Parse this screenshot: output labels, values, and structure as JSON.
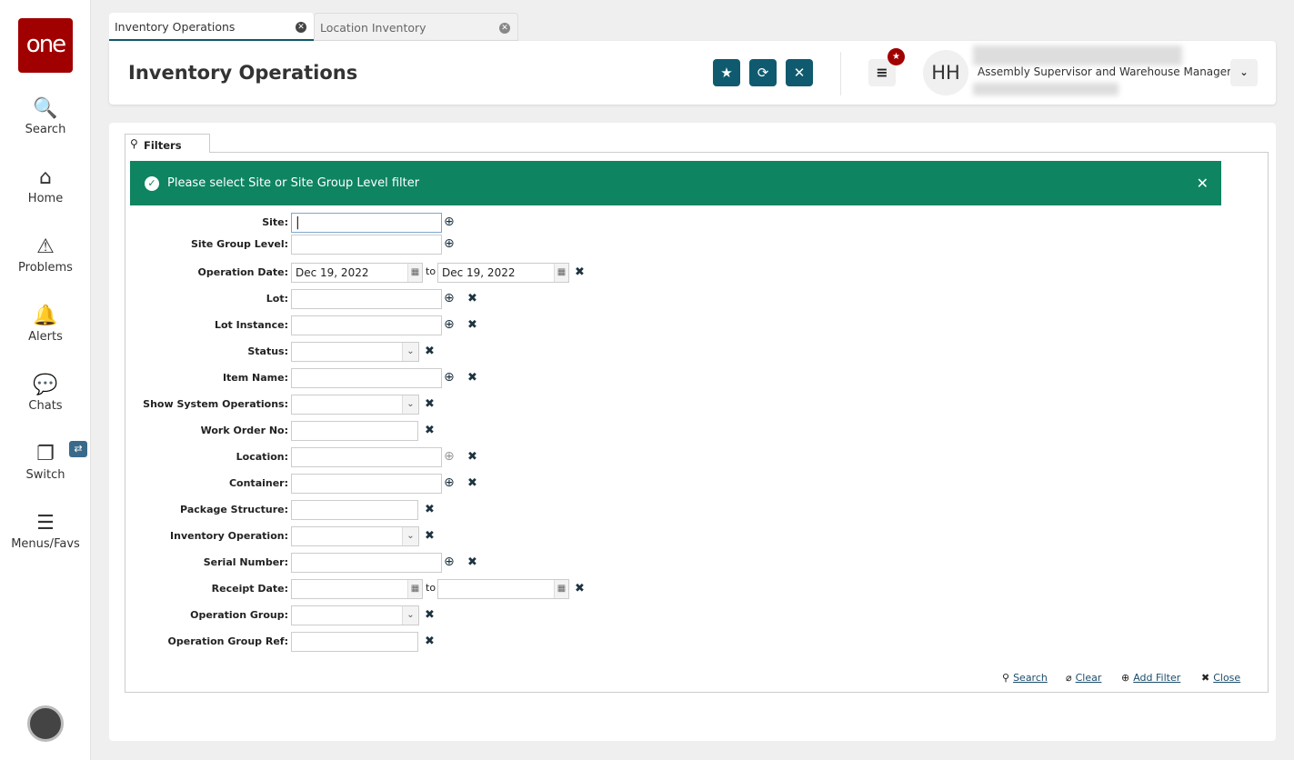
{
  "logo": "one",
  "nav": [
    {
      "label": "Search",
      "icon": "search-icon"
    },
    {
      "label": "Home",
      "icon": "home-icon"
    },
    {
      "label": "Problems",
      "icon": "warning-icon"
    },
    {
      "label": "Alerts",
      "icon": "bell-icon"
    },
    {
      "label": "Chats",
      "icon": "chat-icon"
    },
    {
      "label": "Switch",
      "icon": "switch-icon"
    },
    {
      "label": "Menus/Favs",
      "icon": "menu-icon"
    }
  ],
  "tabs": [
    {
      "label": "Inventory Operations",
      "active": true
    },
    {
      "label": "Location Inventory",
      "active": false
    }
  ],
  "header": {
    "title": "Inventory Operations",
    "initials": "HH",
    "role": "Assembly Supervisor and Warehouse Manager"
  },
  "filters": {
    "tab_label": "Filters",
    "banner": "Please select Site or Site Group Level filter",
    "to_label": "to",
    "fields": [
      {
        "label": "Site:",
        "type": "lookup",
        "clear": false
      },
      {
        "label": "Site Group Level:",
        "type": "lookup",
        "clear": false
      },
      {
        "label": "Operation Date:",
        "type": "date",
        "from": "Dec 19, 2022",
        "to": "Dec 19, 2022"
      },
      {
        "label": "Lot:",
        "type": "lookup",
        "clear": true
      },
      {
        "label": "Lot Instance:",
        "type": "lookup",
        "clear": true
      },
      {
        "label": "Status:",
        "type": "select"
      },
      {
        "label": "Item Name:",
        "type": "lookup",
        "clear": true
      },
      {
        "label": "Show System Operations:",
        "type": "select"
      },
      {
        "label": "Work Order No:",
        "type": "text"
      },
      {
        "label": "Location:",
        "type": "lookup",
        "clear": true,
        "disabled_icon": true
      },
      {
        "label": "Container:",
        "type": "lookup",
        "clear": true
      },
      {
        "label": "Package Structure:",
        "type": "text"
      },
      {
        "label": "Inventory Operation:",
        "type": "select"
      },
      {
        "label": "Serial Number:",
        "type": "lookup",
        "clear": true
      },
      {
        "label": "Receipt Date:",
        "type": "date",
        "from": "",
        "to": ""
      },
      {
        "label": "Operation Group:",
        "type": "select"
      },
      {
        "label": "Operation Group Ref:",
        "type": "text"
      }
    ],
    "actions": {
      "search": "Search",
      "clear": "Clear",
      "add_filter": "Add Filter",
      "close": "Close"
    }
  }
}
